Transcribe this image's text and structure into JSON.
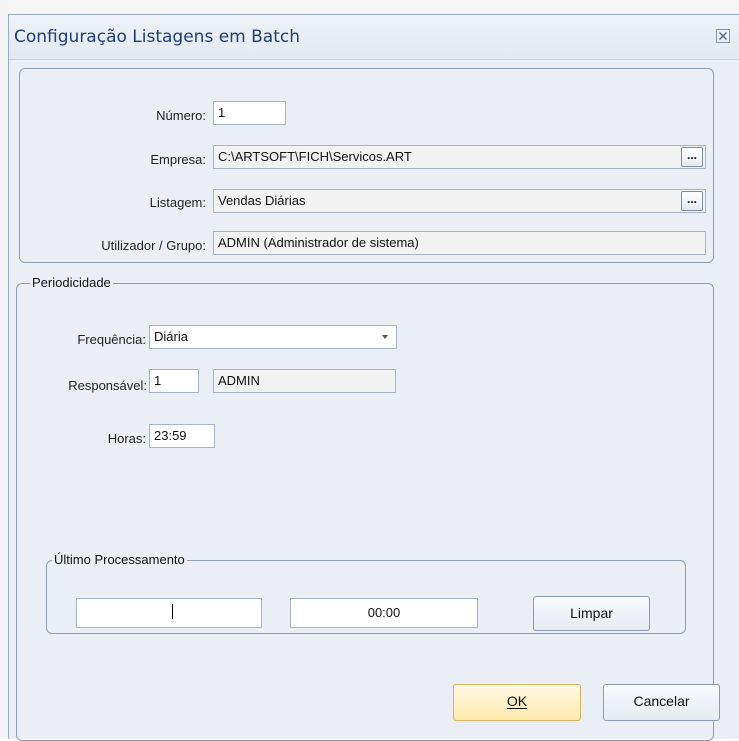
{
  "window": {
    "title": "Configuração Listagens em Batch"
  },
  "general": {
    "numero_label": "Número:",
    "numero_value": "1",
    "empresa_label": "Empresa:",
    "empresa_value": "C:\\ARTSOFT\\FICH\\Servicos.ART",
    "listagem_label": "Listagem:",
    "listagem_value": "Vendas Diárias",
    "utilizador_label": "Utilizador / Grupo:",
    "utilizador_value": "ADMIN (Administrador de sistema)",
    "browse_label": "..."
  },
  "periodicidade": {
    "legend": "Periodicidade",
    "frequencia_label": "Frequência:",
    "frequencia_value": "Diária",
    "responsavel_label": "Responsável:",
    "responsavel_id": "1",
    "responsavel_name": "ADMIN",
    "horas_label": "Horas:",
    "horas_value": "23:59"
  },
  "ultimo_processamento": {
    "legend": "Último Processamento",
    "date_value": "",
    "time_value": "00:00",
    "limpar_label": "Limpar"
  },
  "buttons": {
    "ok_label": "OK",
    "cancel_label": "Cancelar"
  },
  "icons": {
    "close": "close-icon",
    "dropdown": "chevron-down-icon"
  }
}
